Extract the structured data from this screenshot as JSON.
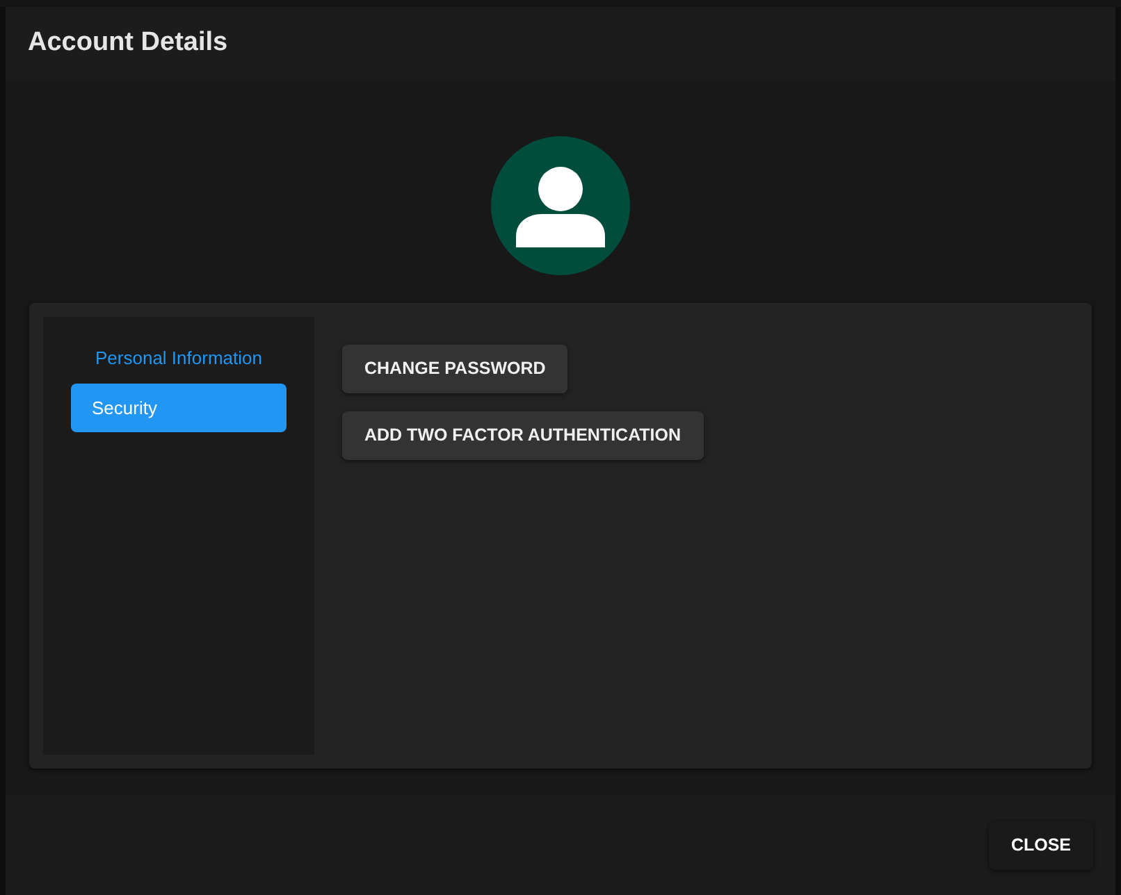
{
  "dialog": {
    "title": "Account Details"
  },
  "sidebar": {
    "items": [
      {
        "label": "Personal Information",
        "selected": false
      },
      {
        "label": "Security",
        "selected": true
      }
    ]
  },
  "actions": [
    "CHANGE PASSWORD",
    "ADD TWO FACTOR AUTHENTICATION"
  ],
  "footer": {
    "buttons": [
      "CLOSE"
    ]
  }
}
